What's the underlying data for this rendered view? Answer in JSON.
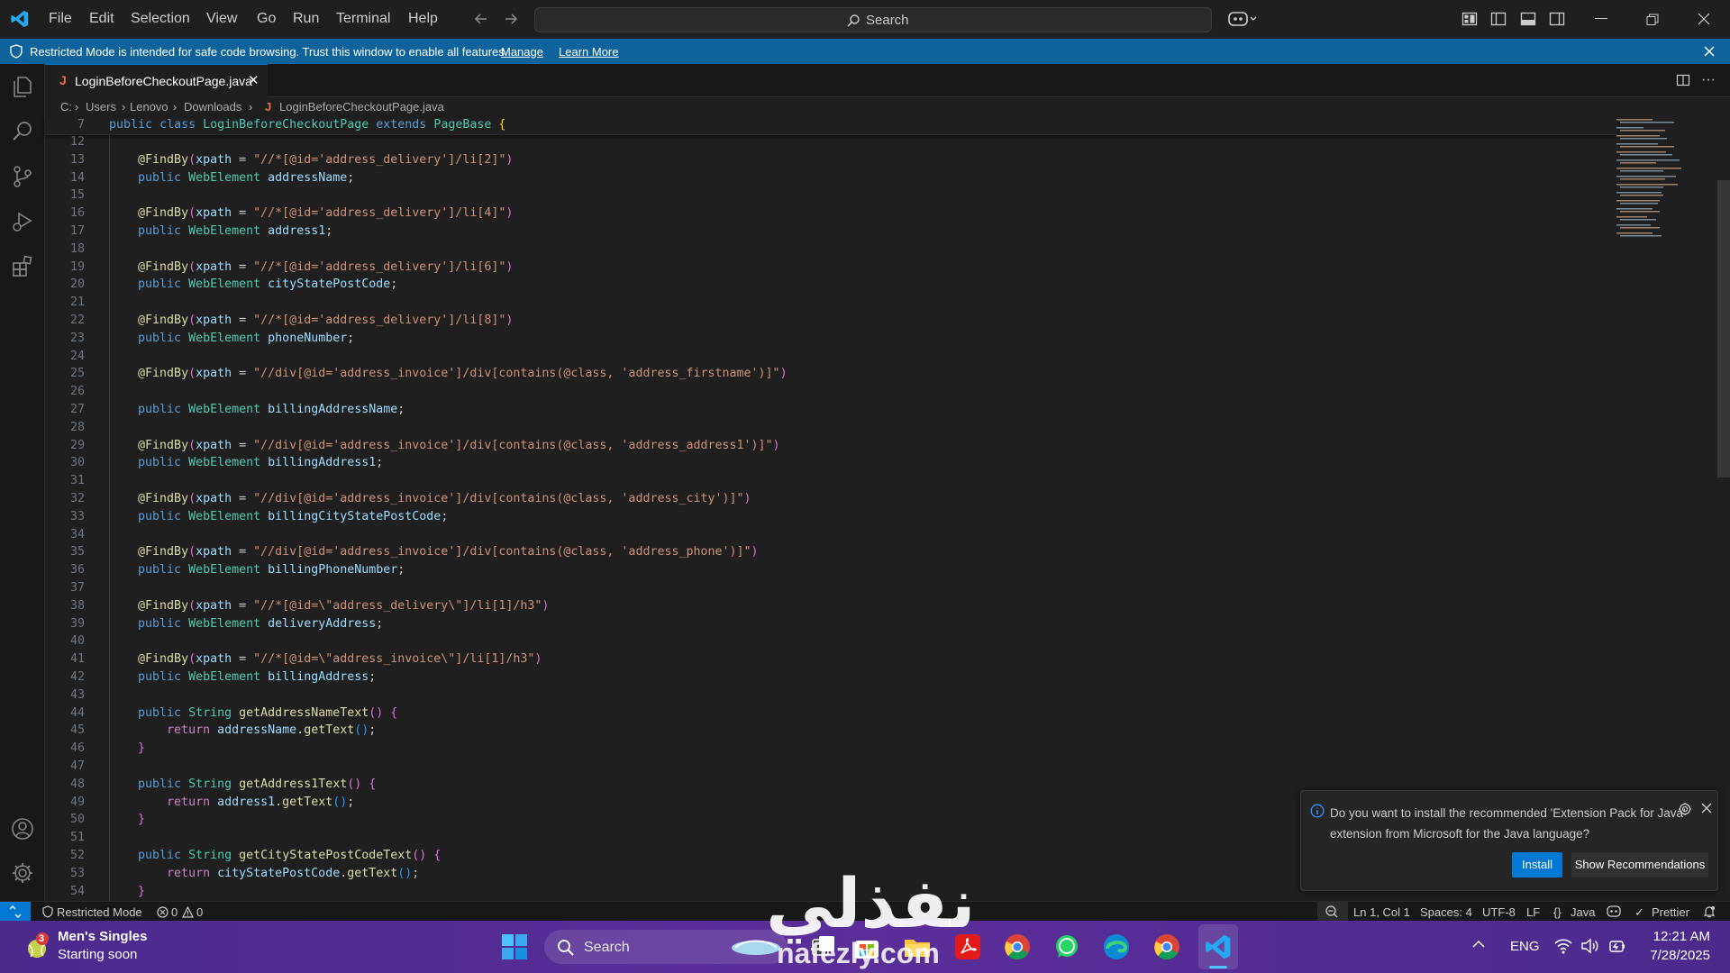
{
  "menu": {
    "items": [
      "File",
      "Edit",
      "Selection",
      "View",
      "Go",
      "Run",
      "Terminal",
      "Help"
    ]
  },
  "search": {
    "label": "Search"
  },
  "banner": {
    "message": "Restricted Mode is intended for safe code browsing. Trust this window to enable all features.",
    "manage": "Manage",
    "learn_more": "Learn More"
  },
  "tab": {
    "icon_letter": "J",
    "filename": "LoginBeforeCheckoutPage.java",
    "close": "✕"
  },
  "breadcrumb": {
    "parts": [
      "C:",
      "Users",
      "Lenovo",
      "Downloads"
    ],
    "file": "LoginBeforeCheckoutPage.java"
  },
  "editor": {
    "sticky_line": "7",
    "lines": [
      "12",
      "13",
      "14",
      "15",
      "16",
      "17",
      "18",
      "19",
      "20",
      "21",
      "22",
      "23",
      "24",
      "25",
      "26",
      "27",
      "28",
      "29",
      "30",
      "31",
      "32",
      "33",
      "34",
      "35",
      "36",
      "37",
      "38",
      "39",
      "40",
      "41",
      "42",
      "43",
      "44",
      "45",
      "46",
      "47",
      "48",
      "49",
      "50",
      "51",
      "52",
      "53",
      "54"
    ]
  },
  "notification": {
    "message": "Do you want to install the recommended 'Extension Pack for Java' extension from Microsoft for the Java language?",
    "install": "Install",
    "show_recommendations": "Show Recommendations"
  },
  "status": {
    "restricted": "Restricted Mode",
    "errors": "0",
    "warnings": "0",
    "position": "Ln 1, Col 1",
    "spaces": "Spaces: 4",
    "encoding": "UTF-8",
    "eol": "LF",
    "language": "Java",
    "prettier": "Prettier"
  },
  "taskbar": {
    "widget_badge": "3",
    "widget_title": "Men's Singles",
    "widget_sub": "Starting soon",
    "search": "Search",
    "lang": "ENG",
    "time": "12:21 AM",
    "date": "7/28/2025"
  },
  "watermark": {
    "arabic": "نفذلي",
    "site": "nafezly.com"
  },
  "colors": {
    "accent": "#0078d4",
    "banner": "#0e639c",
    "taskbar": "#5b2e9a"
  }
}
